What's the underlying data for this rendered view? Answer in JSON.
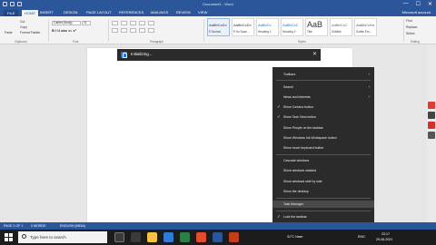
{
  "titlebar": {
    "title": "Document1 - Word",
    "minimize": "—",
    "maximize": "☐",
    "close": "✕"
  },
  "tabs": {
    "file": "FILE",
    "home": "HOME",
    "insert": "INSERT",
    "design": "DESIGN",
    "page_layout": "PAGE LAYOUT",
    "references": "REFERENCES",
    "mailings": "MAILINGS",
    "review": "REVIEW",
    "view": "VIEW",
    "account": "Microsoft account",
    "share": "Share"
  },
  "ribbon": {
    "paste_label": "Paste",
    "cut": "Cut",
    "copy": "Copy",
    "format_painter": "Format Painter",
    "font_name": "Calibri (Body)",
    "font_size": "11",
    "format_buttons": "B I U abc x₂ x²",
    "styles": [
      {
        "sample": "AaBbCcDc",
        "name": "¶ Normal",
        "selected": true
      },
      {
        "sample": "AaBbCcDc",
        "name": "¶ No Spac...",
        "selected": false
      },
      {
        "sample": "AaBbCc",
        "name": "Heading 1",
        "selected": false
      },
      {
        "sample": "AaBbCcC",
        "name": "Heading 2",
        "selected": false
      },
      {
        "sample": "AaB",
        "name": "Title",
        "selected": false,
        "big": true
      },
      {
        "sample": "AaBbCcC",
        "name": "Subtitle",
        "selected": false
      },
      {
        "sample": "AaBbCcDa",
        "name": "Subtle Em...",
        "selected": false
      }
    ],
    "find": "Find",
    "replace": "Replace",
    "select": "Select",
    "groups": {
      "clipboard": "Clipboard",
      "font": "Font",
      "paragraph": "Paragraph",
      "styles": "Styles",
      "editing": "Editing"
    }
  },
  "toast": {
    "text": "Initializing...",
    "close": "✕"
  },
  "context_menu": {
    "items": [
      {
        "label": "Toolbars",
        "arrow": "›"
      },
      {
        "label": "Search",
        "arrow": "›"
      },
      {
        "label": "News and interests",
        "arrow": "›"
      },
      {
        "label": "Show Cortana button",
        "check": "✓"
      },
      {
        "label": "Show Task View button",
        "check": "✓"
      },
      {
        "label": "Show People on the taskbar"
      },
      {
        "label": "Show Windows Ink Workspace button"
      },
      {
        "label": "Show touch keyboard button"
      },
      {
        "label": "Cascade windows"
      },
      {
        "label": "Show windows stacked"
      },
      {
        "label": "Show windows side by side"
      },
      {
        "label": "Show the desktop"
      },
      {
        "label": "Task Manager"
      },
      {
        "label": "Lock the taskbar",
        "check": "✓"
      },
      {
        "label": "Taskbar settings",
        "gear": "⚙"
      }
    ]
  },
  "statusbar": {
    "page": "PAGE 1 OF 1",
    "words": "0 WORDS",
    "language": "ENGLISH (INDIA)"
  },
  "taskbar": {
    "search_placeholder": "Type here to search",
    "weather": "31°C Haze",
    "language": "ENG",
    "time": "23:17",
    "date": "29-06-2021"
  },
  "colors": {
    "word_blue": "#2b579a",
    "menu_bg": "#2b2b2b",
    "taskbar_bg": "#1c1c1c"
  }
}
